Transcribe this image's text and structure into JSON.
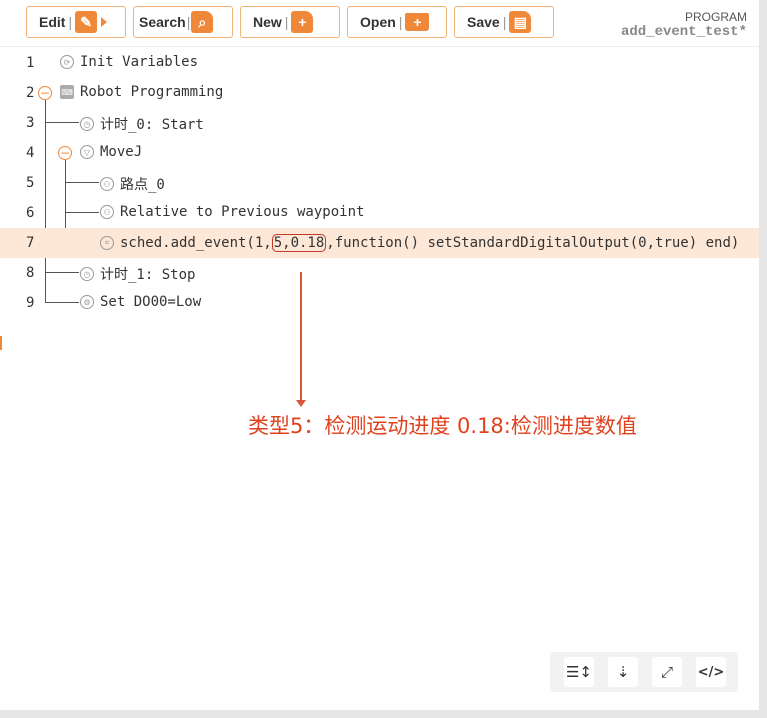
{
  "toolbar": {
    "edit_label": "Edit",
    "search_label": "Search",
    "new_label": "New",
    "open_label": "Open",
    "save_label": "Save",
    "separator": "|"
  },
  "program": {
    "label": "PROGRAM",
    "name": "add_event_test*"
  },
  "tree": {
    "rows": [
      {
        "num": "1",
        "text": "Init Variables"
      },
      {
        "num": "2",
        "text": "Robot Programming"
      },
      {
        "num": "3",
        "text": "计时_0: Start"
      },
      {
        "num": "4",
        "text": "MoveJ"
      },
      {
        "num": "5",
        "text": "路点_0"
      },
      {
        "num": "6",
        "text": "Relative to Previous waypoint"
      },
      {
        "num": "7",
        "text_pre": "sched.add_event(1,",
        "text_boxed": "5,0.18",
        "text_post": ",function() setStandardDigitalOutput(0,true) end)"
      },
      {
        "num": "8",
        "text": "计时_1: Stop"
      },
      {
        "num": "9",
        "text": "Set DO00=Low"
      }
    ]
  },
  "annotation": {
    "text": "类型5：检测运动进度   0.18:检测进度数值",
    "color": "#e0421e"
  },
  "bottom_tools": {
    "b1": "☰↕",
    "b2": "⇣",
    "b3": "⤢",
    "b4": "</>"
  },
  "colors": {
    "accent": "#f0883a",
    "highlight_row": "#fde7d7"
  }
}
